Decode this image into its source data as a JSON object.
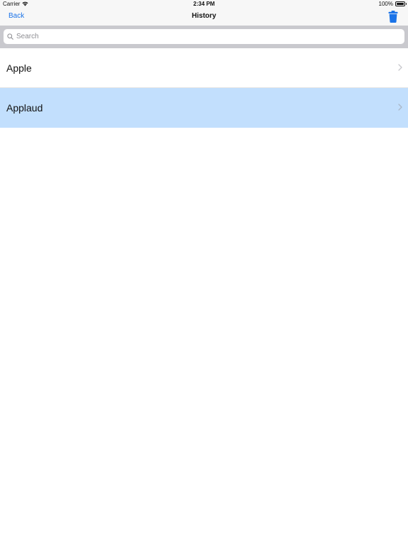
{
  "status_bar": {
    "carrier": "Carrier",
    "time": "2:34 PM",
    "battery": "100%"
  },
  "nav": {
    "back_label": "Back",
    "title": "History"
  },
  "search": {
    "placeholder": "Search",
    "value": ""
  },
  "history": {
    "items": [
      {
        "label": "Apple",
        "selected": false
      },
      {
        "label": "Applaud",
        "selected": true
      }
    ]
  },
  "colors": {
    "accent": "#1a73e8",
    "selected_row": "#c2dffd",
    "search_bar_bg": "#c9c9ce"
  },
  "icons": {
    "wifi": "wifi-icon",
    "battery": "battery-icon",
    "trash": "trash-icon",
    "search": "search-icon",
    "chevron": "chevron-right-icon"
  }
}
